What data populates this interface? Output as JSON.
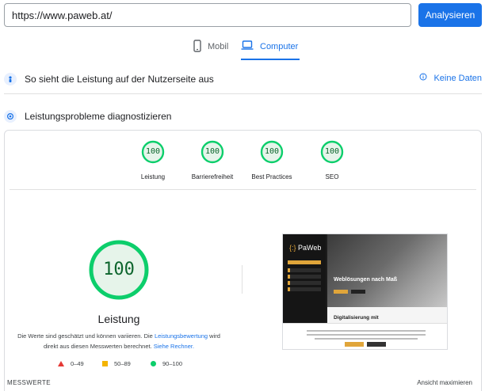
{
  "search": {
    "url_value": "https://www.paweb.at/",
    "analyze_label": "Analysieren"
  },
  "tabs": [
    {
      "label": "Mobil",
      "icon": "smartphone-icon",
      "active": false
    },
    {
      "label": "Computer",
      "icon": "laptop-icon",
      "active": true
    }
  ],
  "sections": {
    "user_experience": {
      "title": "So sieht die Leistung auf der Nutzerseite aus",
      "no_data_label": "Keine Daten"
    },
    "diagnose": {
      "title": "Leistungsprobleme diagnostizieren"
    }
  },
  "scores": [
    {
      "value": 100,
      "label": "Leistung"
    },
    {
      "value": 100,
      "label": "Barrierefreiheit"
    },
    {
      "value": 100,
      "label": "Best Practices"
    },
    {
      "value": 100,
      "label": "SEO"
    }
  ],
  "performance": {
    "value": 100,
    "title": "Leistung",
    "desc_part1": "Die Werte sind geschätzt und können variieren. Die ",
    "desc_link1": "Leistungsbewertung",
    "desc_part2": " wird direkt aus diesen Messwerten berechnet. ",
    "desc_link2": "Siehe Rechner."
  },
  "legend": [
    {
      "range": "0–49",
      "shape": "triangle",
      "color": "#e53935"
    },
    {
      "range": "50–89",
      "shape": "square",
      "color": "#f4b400"
    },
    {
      "range": "90–100",
      "shape": "circle",
      "color": "#0cce6b"
    }
  ],
  "thumbnail": {
    "logo_bracket": "{:}",
    "logo_text": "PaWeb",
    "hero_title": "Weblösungen nach Maß",
    "section_title": "Digitalisierung mit"
  },
  "footer": {
    "metrics_label": "MESSWERTE",
    "maximize_label": "Ansicht maximieren"
  },
  "colors": {
    "accent": "#1a73e8",
    "pass": "#0cce6b",
    "pass_text": "#0d652d",
    "pass_bg": "#e6f4ea"
  }
}
